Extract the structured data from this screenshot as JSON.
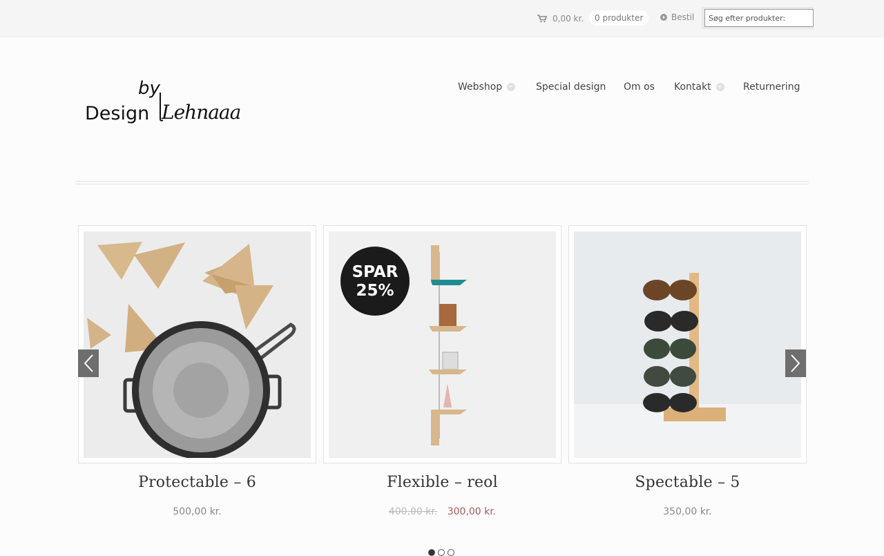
{
  "topbar": {
    "cart_total": "0,00 kr.",
    "cart_count": "0 produkter",
    "checkout_label": "Bestil",
    "search_placeholder": "Søg efter produkter:"
  },
  "logo": {
    "top_text": "by",
    "main_text": "Design",
    "script_text": "Lehnaaa"
  },
  "nav": {
    "items": [
      {
        "label": "Webshop",
        "has_dropdown": true
      },
      {
        "label": "Special design",
        "has_dropdown": false
      },
      {
        "label": "Om os",
        "has_dropdown": false
      },
      {
        "label": "Kontakt",
        "has_dropdown": true
      },
      {
        "label": "Returnering",
        "has_dropdown": false
      }
    ]
  },
  "products": [
    {
      "title": "Protectable – 6",
      "price": "500,00 kr.",
      "image": "wooden-triangles-and-pan"
    },
    {
      "title": "Flexible – reol",
      "old_price": "400,00 kr.",
      "price": "300,00 kr.",
      "badge": "SPAR 25%",
      "image": "wall-shelf"
    },
    {
      "title": "Spectable – 5",
      "price": "350,00 kr.",
      "image": "sunglasses-stand"
    }
  ],
  "slider": {
    "dots": 3,
    "active": 0
  },
  "colors": {
    "sale": "#a85a5a",
    "arrow_bg": "#6e6e6e",
    "topbar_bg": "#f5f5f5"
  }
}
